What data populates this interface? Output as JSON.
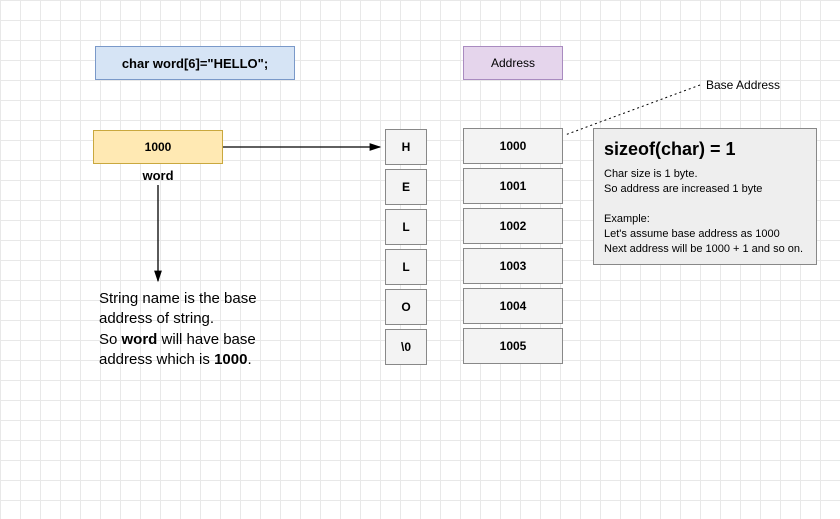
{
  "declaration": "char word[6]=\"HELLO\";",
  "addressHeader": "Address",
  "baseValue": "1000",
  "varName": "word",
  "chars": [
    "H",
    "E",
    "L",
    "L",
    "O",
    "\\0"
  ],
  "addrs": [
    "1000",
    "1001",
    "1002",
    "1003",
    "1004",
    "1005"
  ],
  "baseLabel": "Base Address",
  "explain": {
    "title": "sizeof(char) = 1",
    "p1": "Char size is 1 byte.",
    "p2": "So address are increased 1 byte",
    "exHead": "Example:",
    "ex1": "Let's assume base address as 1000",
    "ex2": "Next address will be 1000 + 1 and so on."
  },
  "stringText": {
    "l1": "String name is the base address of string.",
    "l2a": "So ",
    "l2b": "word",
    "l2c": " will have base address which is ",
    "l2d": "1000",
    "l2e": "."
  }
}
